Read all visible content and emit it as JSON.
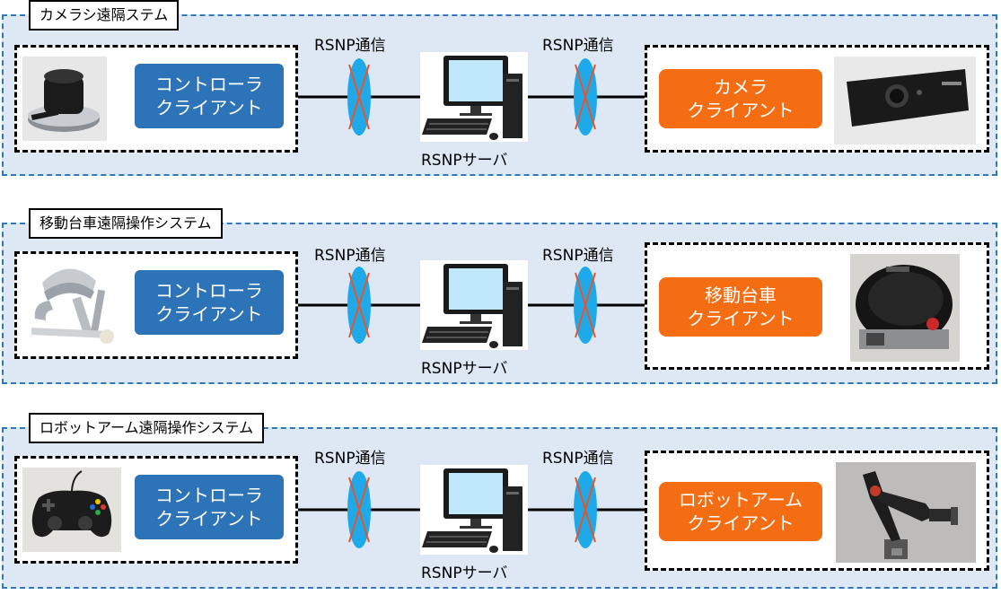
{
  "systems": [
    {
      "title": "カメラシ遠隔ステム",
      "left_client": {
        "line1": "コントローラ",
        "line2": "クライアント",
        "device_icon": "spacemouse-photo"
      },
      "link_left_label": "RSNP通信",
      "link_right_label": "RSNP通信",
      "server_label": "RSNPサーバ",
      "right_client": {
        "line1": "カメラ",
        "line2": "クライアント",
        "device_icon": "camera-photo"
      }
    },
    {
      "title": "移動台車遠隔操作システム",
      "left_client": {
        "line1": "コントローラ",
        "line2": "クライアント",
        "device_icon": "haptic-device-photo"
      },
      "link_left_label": "RSNP通信",
      "link_right_label": "RSNP通信",
      "server_label": "RSNPサーバ",
      "right_client": {
        "line1": "移動台車",
        "line2": "クライアント",
        "device_icon": "mobile-robot-photo"
      }
    },
    {
      "title": "ロボットアーム遠隔操作システム",
      "left_client": {
        "line1": "コントローラ",
        "line2": "クライアント",
        "device_icon": "gamepad-photo"
      },
      "link_left_label": "RSNP通信",
      "link_right_label": "RSNP通信",
      "server_label": "RSNPサーバ",
      "right_client": {
        "line1": "ロボットアーム",
        "line2": "クライアント",
        "device_icon": "robot-arm-photo"
      }
    }
  ],
  "colors": {
    "panel_bg": "#dde8f4",
    "panel_border": "#2f79b9",
    "controller_label_bg": "#2d73b8",
    "device_label_bg": "#f56d12",
    "link_ellipse": "#1fa9e8",
    "link_cross": "#e8542a"
  }
}
